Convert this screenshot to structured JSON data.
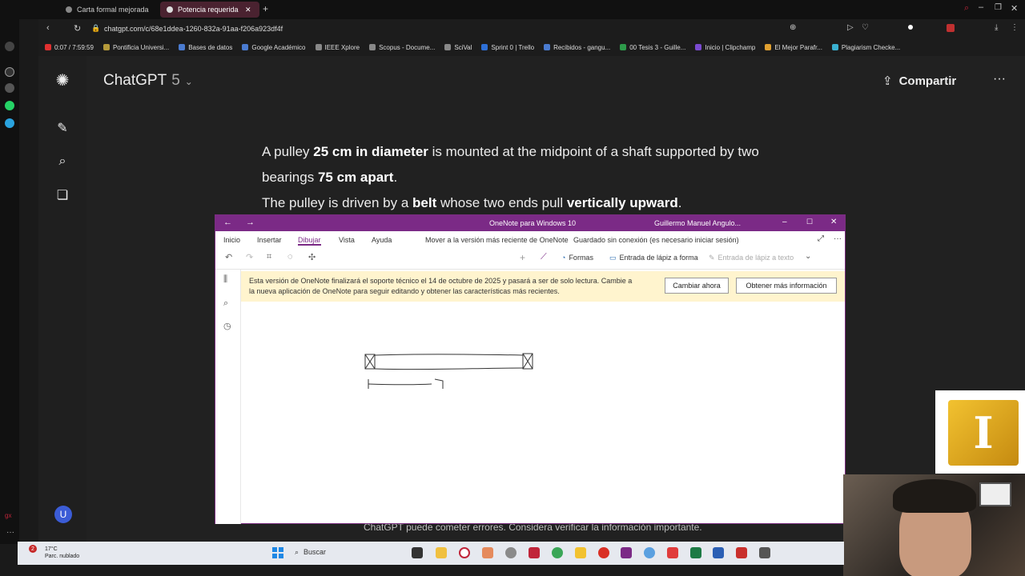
{
  "browser": {
    "tabs": [
      {
        "label": "Carta formal mejorada",
        "active": false
      },
      {
        "label": "Potencia requerida a",
        "active": true
      }
    ],
    "url": "chatgpt.com/c/68e1ddea-1260-832a-91aa-f206a923df4f",
    "bookmarks": [
      {
        "label": "0:07 / 7:59:59",
        "color": "#e03030"
      },
      {
        "label": "Pontificia Universi...",
        "color": "#b59a3a"
      },
      {
        "label": "Bases de datos",
        "color": "#4a7bd0"
      },
      {
        "label": "Google Académico",
        "color": "#4a7bd0"
      },
      {
        "label": "IEEE Xplore",
        "color": "#888888"
      },
      {
        "label": "Scopus - Docume...",
        "color": "#888888"
      },
      {
        "label": "SciVal",
        "color": "#888888"
      },
      {
        "label": "Sprint 0 | Trello",
        "color": "#2d6fd6"
      },
      {
        "label": "Recibidos - gangu...",
        "color": "#4a7bd0"
      },
      {
        "label": "00 Tesis 3 - Guille...",
        "color": "#2d9a4a"
      },
      {
        "label": "Inicio | Clipchamp",
        "color": "#7a4ad0"
      },
      {
        "label": "El Mejor Parafr...",
        "color": "#e0a030"
      },
      {
        "label": "Plagiarism Checke...",
        "color": "#3ab0d0"
      }
    ]
  },
  "chatgpt": {
    "model_label": "ChatGPT",
    "model_version": "5",
    "share_label": "Compartir",
    "avatar_letter": "U",
    "footer_note": "ChatGPT puede cometer errores. Considera verificar la información importante.",
    "message": {
      "line1_a": "A pulley ",
      "line1_b": "25 cm in diameter",
      "line1_c": " is mounted at the midpoint of a shaft supported by two",
      "line2_a": "bearings ",
      "line2_b": "75 cm apart",
      "line2_c": ".",
      "line3_a": "The pulley is driven by a ",
      "line3_b": "belt",
      "line3_c": " whose two ends pull ",
      "line3_d": "vertically upward",
      "line3_e": "."
    }
  },
  "onenote": {
    "title": "OneNote para Windows 10",
    "user": "Guillermo Manuel Angulo...",
    "menu": [
      "Inicio",
      "Insertar",
      "Dibujar",
      "Vista",
      "Ayuda"
    ],
    "active_menu": "Dibujar",
    "upgrade_link": "Mover a la versión más reciente de OneNote",
    "sync_status": "Guardado sin conexión (es necesario iniciar sesión)",
    "tools": {
      "shapes": "Formas",
      "ink_to_shape": "Entrada de lápiz a forma",
      "ink_to_text": "Entrada de lápiz a texto"
    },
    "banner": {
      "line1": "Esta versión de OneNote finalizará el soporte técnico el 14 de octubre de 2025 y pasará a ser de solo lectura. Cambie a",
      "line2": "la nueva aplicación de OneNote para seguir editando y obtener las características más recientes.",
      "switch_button": "Cambiar ahora",
      "more_button": "Obtener más información"
    },
    "pen_colors": [
      "#c0504d",
      "#222222",
      "#1f9fbf",
      "#2e8b3a",
      "#f0d000",
      "#222222",
      "#c0504d",
      "#1f9fbf",
      "#222222"
    ]
  },
  "taskbar": {
    "weather_temp": "17°C",
    "weather_desc": "Parc. nublado",
    "weather_badge": "2",
    "search_label": "Buscar"
  }
}
